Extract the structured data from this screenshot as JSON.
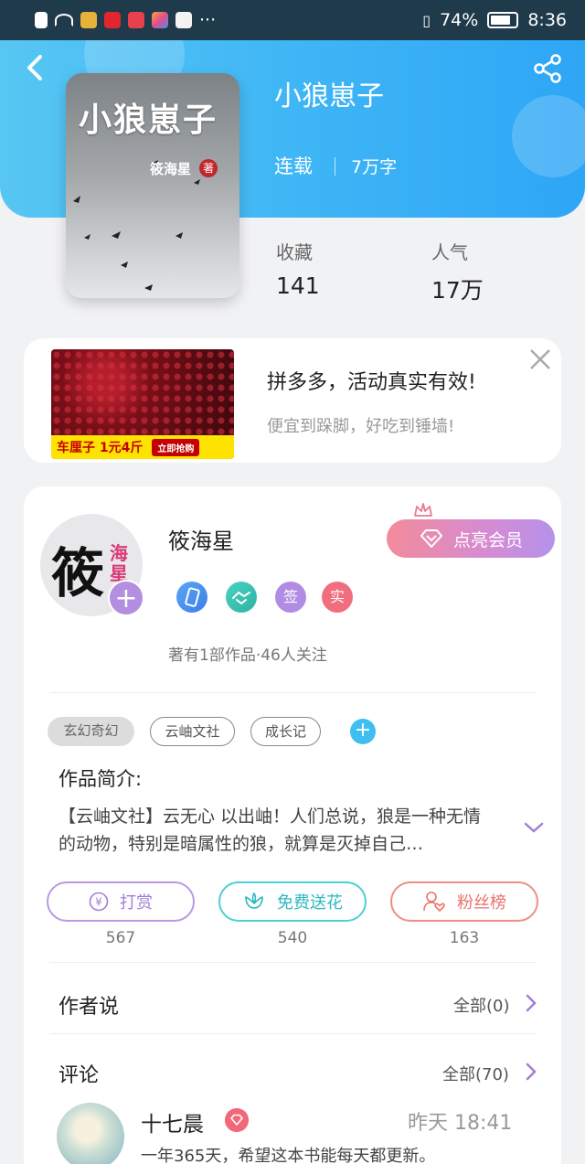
{
  "status_bar": {
    "battery": "74%",
    "time": "8:36",
    "more": "···"
  },
  "book": {
    "title": "小狼崽子",
    "status": "连载",
    "word_count": "7万字",
    "cover_title": "小狼崽子",
    "cover_author": "筱海星",
    "cover_seal": "著",
    "stats": [
      {
        "label": "收藏",
        "value": "141"
      },
      {
        "label": "人气",
        "value": "17万"
      }
    ]
  },
  "ad": {
    "title": "拼多多，活动真实有效!",
    "subtitle": "便宜到跺脚，好吃到锤墙!",
    "banner_text": "车厘子 1元4斤",
    "banner_button": "立即抢购"
  },
  "author": {
    "name": "筱海星",
    "avatar_big": "筱",
    "avatar_small": "海星",
    "vip_button": "点亮会员",
    "badges": [
      "签",
      "实"
    ],
    "meta": "著有1部作品·46人关注",
    "add_symbol": "+"
  },
  "tags": [
    "玄幻奇幻",
    "云岫文社",
    "成长记"
  ],
  "intro": {
    "title": "作品简介:",
    "text": "【云岫文社】云无心 以出岫！人们总说，狼是一种无情的动物，特别是暗属性的狼，就算是灭掉自己…"
  },
  "actions": [
    {
      "label": "打赏",
      "count": "567",
      "color": "#b79ae4"
    },
    {
      "label": "免费送花",
      "count": "540",
      "color": "#4ccfd4"
    },
    {
      "label": "粉丝榜",
      "count": "163",
      "color": "#ef8d86"
    }
  ],
  "author_says": {
    "title": "作者说",
    "more": "全部(0)"
  },
  "comments": {
    "title": "评论",
    "more": "全部(70)",
    "first": {
      "name": "十七晨",
      "time": "昨天 18:41",
      "text": "一年365天，希望这本书能每天都更新。"
    }
  },
  "colors": {
    "header_start": "#57c6f3",
    "header_end": "#2ea6f6",
    "accent_blue": "#3fbef1"
  }
}
